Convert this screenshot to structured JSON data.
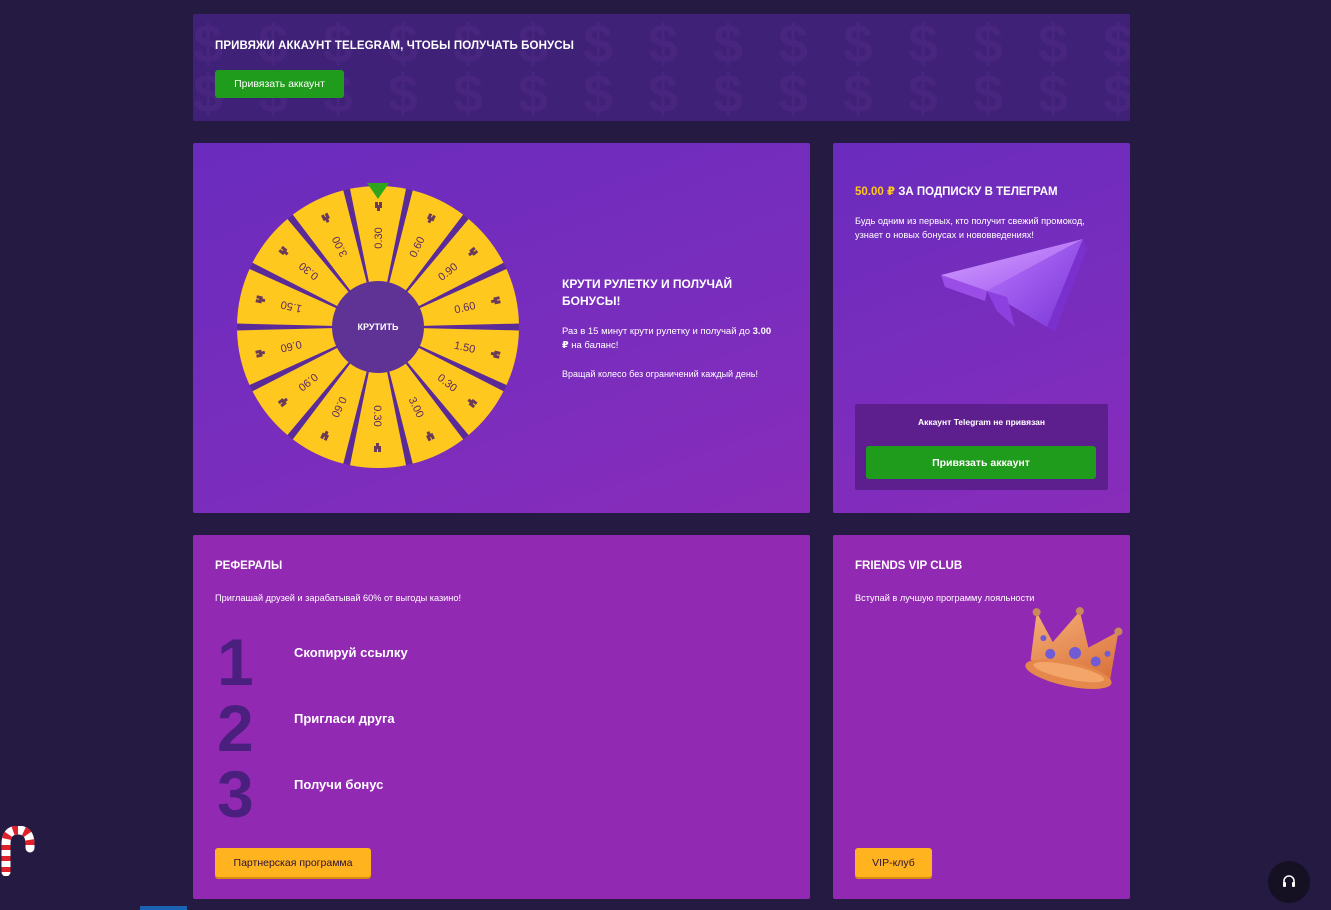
{
  "banner": {
    "title": "ПРИВЯЖИ АККАУНТ TELEGRAM, ЧТОБЫ ПОЛУЧАТЬ БОНУСЫ",
    "button_label": "Привязать аккаунт"
  },
  "wheel": {
    "spin_label": "КРУТИТЬ",
    "title": "КРУТИ РУЛЕТКУ И ПОЛУЧАЙ БОНУСЫ!",
    "desc_prefix": "Раз в 15 минут крути рулетку и получай до",
    "desc_amount": "3.00 ₽",
    "desc_suffix": "на баланс!",
    "note": "Вращай колесо без ограничений каждый день!",
    "segments": [
      "0.30",
      "0.60",
      "0.90",
      "0.60",
      "1.50",
      "0.30",
      "3.00",
      "0.30",
      "0.60",
      "0.90",
      "0.60",
      "1.50",
      "0.30",
      "3.00"
    ],
    "coin_icon": "coins-icon",
    "colors": {
      "segment": "#ffc81f",
      "divider": "#5b2a99",
      "hub": "#5f3296",
      "pointer": "#2fa51b"
    }
  },
  "telegram": {
    "amount": "50.00 ₽",
    "title_suffix": "ЗА ПОДПИСКУ В ТЕЛЕГРАМ",
    "desc": "Будь одним из первых, кто получит свежий промокод, узнает о новых бонусах и нововведениях!",
    "status": "Аккаунт Telegram не привязан",
    "button_label": "Привязать аккаунт",
    "icon": "paper-plane-icon"
  },
  "referrals": {
    "title": "РЕФЕРАЛЫ",
    "desc": "Приглашай друзей и зарабатывай 60% от выгоды казино!",
    "steps": [
      {
        "num": "1",
        "label": "Скопируй ссылку"
      },
      {
        "num": "2",
        "label": "Пригласи друга"
      },
      {
        "num": "3",
        "label": "Получи бонус"
      }
    ],
    "button_label": "Партнерская программа"
  },
  "vip": {
    "title": "FRIENDS VIP CLUB",
    "desc": "Вступай в лучшую программу лояльности",
    "button_label": "VIP-клуб",
    "icon": "crown-icon"
  },
  "support": {
    "icon": "headset-icon"
  },
  "decor": {
    "icon": "candy-cane-icon"
  },
  "colors": {
    "page_bg": "#241a42",
    "accent_green": "#1f9c1b",
    "accent_yellow": "#ffb31f",
    "amount_yellow": "#ffc81a"
  }
}
